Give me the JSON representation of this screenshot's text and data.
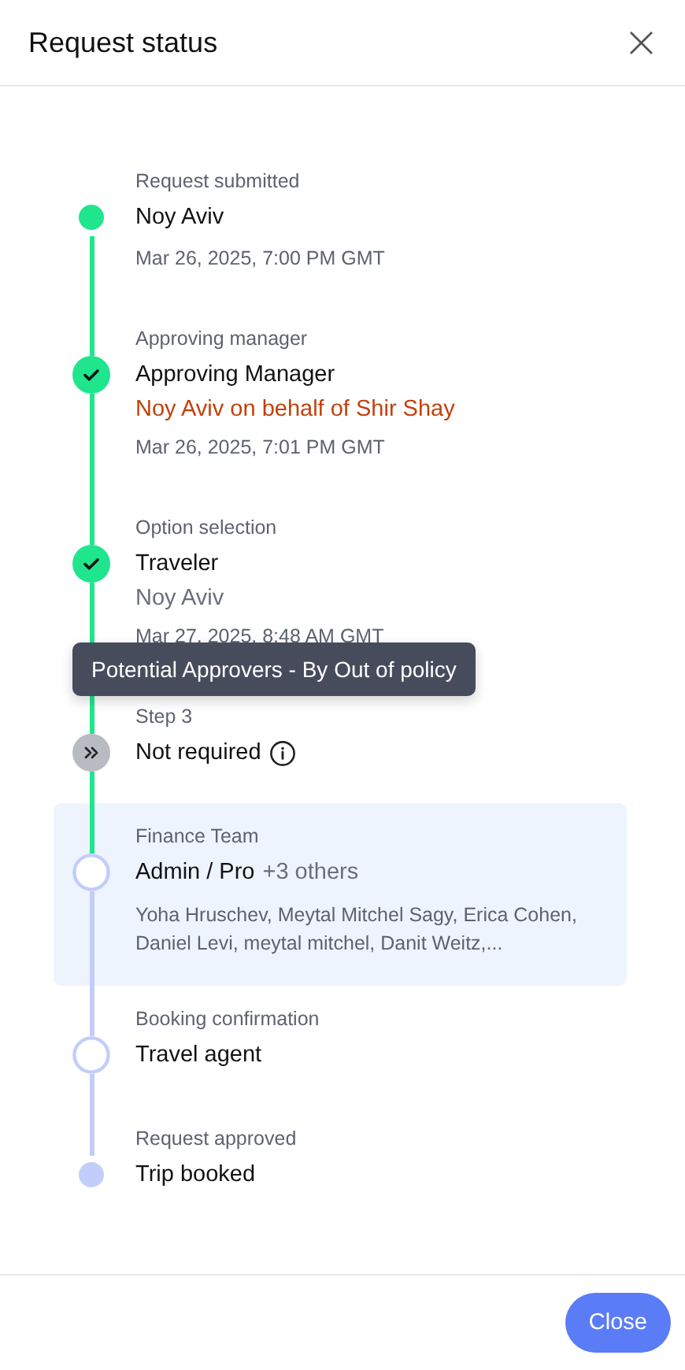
{
  "header": {
    "title": "Request status",
    "close_icon": "×"
  },
  "steps": [
    {
      "kind": "dot",
      "label": "Request submitted",
      "title": "Noy Aviv",
      "date": "Mar 26, 2025, 7:00 PM GMT",
      "highlighted": false
    },
    {
      "kind": "check",
      "label": "Approving manager",
      "title": "Approving Manager",
      "sub": {
        "text": "Noy Aviv on behalf of Shir Shay",
        "alert": true
      },
      "date": "Mar 26, 2025, 7:01 PM GMT",
      "highlighted": false
    },
    {
      "kind": "check",
      "label": "Option selection",
      "title": "Traveler",
      "sub": {
        "text": "Noy Aviv",
        "alert": false
      },
      "date": "Mar 27, 2025, 8:48 AM GMT",
      "highlighted": false
    },
    {
      "kind": "skip",
      "label": "Step 3",
      "title": "Not required",
      "info": true,
      "tooltip": "Potential Approvers - By Out of policy",
      "highlighted": false
    },
    {
      "kind": "ring",
      "label": "Finance Team",
      "title": "Admin / Pro",
      "extra": "+3 others",
      "names": "Yoha Hruschev, Meytal Mitchel Sagy, Erica Cohen, Daniel Levi, meytal mitchel, Danit Weitz,...",
      "highlighted": true
    },
    {
      "kind": "ring",
      "label": "Booking confirmation",
      "title": "Travel agent",
      "highlighted": false
    },
    {
      "kind": "pending_dot",
      "label": "Request approved",
      "title": "Trip booked",
      "highlighted": false
    }
  ],
  "footer": {
    "button": "Close"
  }
}
